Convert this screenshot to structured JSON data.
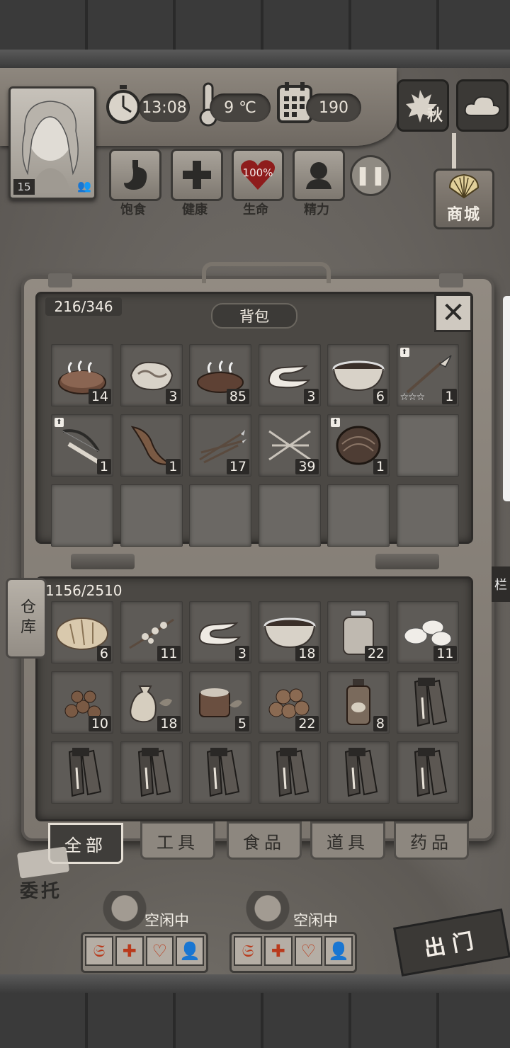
{
  "hud": {
    "time": "13:08",
    "temperature": "9 ℃",
    "days": "190",
    "player_level": "15",
    "season": "秋",
    "shop_label": "商城",
    "stats": [
      {
        "id": "hunger",
        "label": "饱食"
      },
      {
        "id": "health",
        "label": "健康"
      },
      {
        "id": "life",
        "label": "生命",
        "value": "100%"
      },
      {
        "id": "energy",
        "label": "精力"
      }
    ]
  },
  "backpack": {
    "title": "背包",
    "capacity": "216/346",
    "rows": [
      [
        {
          "icon": "cooked-meat-icon",
          "qty": "14"
        },
        {
          "icon": "raw-meat-icon",
          "qty": "3"
        },
        {
          "icon": "roasted-meat-icon",
          "qty": "85"
        },
        {
          "icon": "cloth-strip-icon",
          "qty": "3"
        },
        {
          "icon": "soup-bowl-icon",
          "qty": "6"
        },
        {
          "icon": "spear-icon",
          "qty": "1",
          "upgrade": true,
          "stars": "☆☆☆"
        }
      ],
      [
        {
          "icon": "crossbow-icon",
          "qty": "1",
          "upgrade": true
        },
        {
          "icon": "horn-icon",
          "qty": "1"
        },
        {
          "icon": "arrows-icon",
          "qty": "17"
        },
        {
          "icon": "bolts-icon",
          "qty": "39"
        },
        {
          "icon": "shield-icon",
          "qty": "1",
          "upgrade": true
        },
        {
          "empty": true
        }
      ],
      [
        {
          "empty": true
        },
        {
          "empty": true
        },
        {
          "empty": true
        },
        {
          "empty": true
        },
        {
          "empty": true
        },
        {
          "empty": true
        }
      ]
    ]
  },
  "storage": {
    "tab_label": "仓库",
    "capacity": "1156/2510",
    "rows": [
      [
        {
          "icon": "bread-icon",
          "qty": "6"
        },
        {
          "icon": "herb-branch-icon",
          "qty": "11"
        },
        {
          "icon": "cloth-strip-icon",
          "qty": "3"
        },
        {
          "icon": "soup-bowl-icon",
          "qty": "18"
        },
        {
          "icon": "jar-icon",
          "qty": "22"
        },
        {
          "icon": "pills-icon",
          "qty": "11"
        }
      ],
      [
        {
          "icon": "nuts-icon",
          "qty": "10"
        },
        {
          "icon": "herb-sack-icon",
          "qty": "18"
        },
        {
          "icon": "tea-cup-icon",
          "qty": "5"
        },
        {
          "icon": "potatoes-icon",
          "qty": "22"
        },
        {
          "icon": "bottle-icon",
          "qty": "8"
        },
        {
          "icon": "blueprint-scroll-icon"
        }
      ],
      [
        {
          "icon": "blueprint-scroll-icon"
        },
        {
          "icon": "blueprint-scroll-icon"
        },
        {
          "icon": "blueprint-scroll-icon"
        },
        {
          "icon": "blueprint-scroll-icon"
        },
        {
          "icon": "blueprint-scroll-icon"
        },
        {
          "icon": "blueprint-scroll-icon"
        }
      ]
    ]
  },
  "categories": [
    {
      "label": "全部",
      "active": true
    },
    {
      "label": "工具"
    },
    {
      "label": "食品"
    },
    {
      "label": "道具"
    },
    {
      "label": "药品"
    }
  ],
  "bottom": {
    "commission_label": "委托",
    "survivors": [
      {
        "status": "空闲中"
      },
      {
        "status": "空闲中"
      }
    ],
    "go_out_label": "出门",
    "side_tag": "栏"
  }
}
